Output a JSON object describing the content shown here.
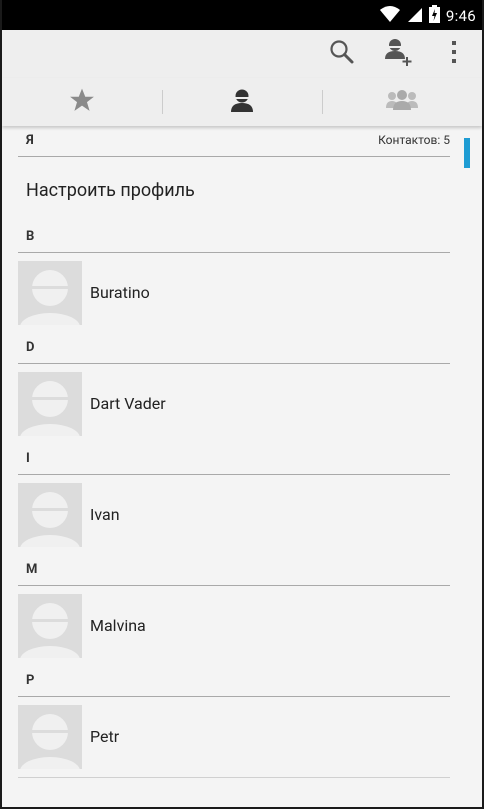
{
  "status_bar": {
    "time": "9:46",
    "icons": [
      "wifi-icon",
      "signal-icon",
      "battery-charging-icon"
    ]
  },
  "action_bar": {
    "icons": [
      "search-icon",
      "add-contact-icon",
      "overflow-menu-icon"
    ]
  },
  "tabs": [
    {
      "icon": "star-icon",
      "name": "favorites",
      "selected": false
    },
    {
      "icon": "person-icon",
      "name": "contacts",
      "selected": true
    },
    {
      "icon": "group-icon",
      "name": "groups",
      "selected": false
    }
  ],
  "me_section": {
    "letter": "Я",
    "count": "Контактов: 5",
    "profile": "Настроить профиль"
  },
  "sections": [
    {
      "letter": "B",
      "contact": "Buratino"
    },
    {
      "letter": "D",
      "contact": "Dart Vader"
    },
    {
      "letter": "I",
      "contact": "Ivan"
    },
    {
      "letter": "M",
      "contact": "Malvina"
    },
    {
      "letter": "P",
      "contact": "Petr"
    }
  ],
  "colors": {
    "accent": "#1e9cd3",
    "background": "#f4f4f4",
    "actionbar": "#eeeeee"
  }
}
